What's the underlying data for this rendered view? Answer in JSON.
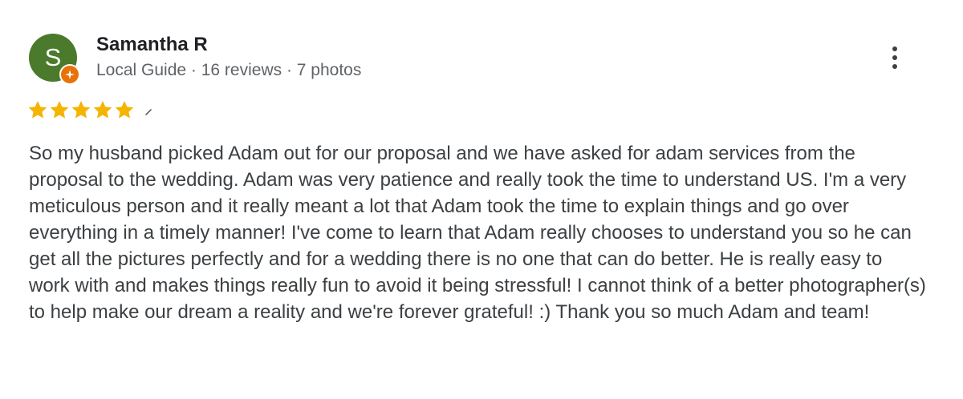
{
  "reviewer": {
    "avatar_letter": "S",
    "avatar_color": "#4b7a2c",
    "badge_color": "#e8710a",
    "badge_icon": "local-guide-star-icon",
    "name": "Samantha R",
    "meta": "Local Guide · 16 reviews · 7 photos"
  },
  "rating": {
    "stars": 5,
    "max_stars": 5,
    "star_color": "#f4b400"
  },
  "review": {
    "text": "So my husband picked Adam out for our proposal and we have asked for adam services from the proposal to the wedding. Adam was very patience and really took the time to understand US. I'm a very meticulous person and it really meant a lot that Adam took the time to explain things and go over everything in a timely manner! I've come to learn that Adam really chooses to understand you so he can get all the pictures perfectly and for a wedding there is no one that can do better. He is really easy to work with and makes things really fun to avoid it being stressful! I cannot think of a better photographer(s) to help make our dream a reality and we're forever grateful! :) Thank you so much Adam and team!"
  },
  "menu": {
    "icon": "more-vert-icon"
  }
}
